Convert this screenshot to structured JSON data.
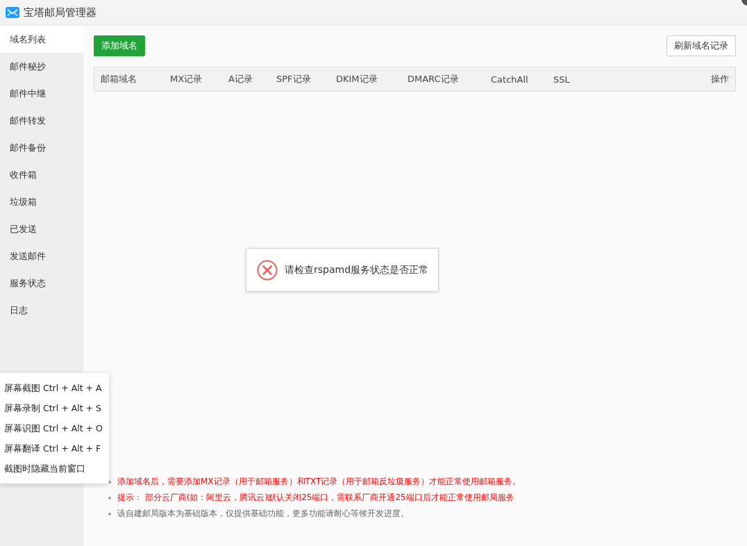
{
  "window": {
    "title": "宝塔邮局管理器"
  },
  "sidebar": {
    "items": [
      {
        "label": "域名列表",
        "selected": true
      },
      {
        "label": "邮件秘抄",
        "selected": false
      },
      {
        "label": "邮件中继",
        "selected": false
      },
      {
        "label": "邮件转发",
        "selected": false
      },
      {
        "label": "邮件备份",
        "selected": false
      },
      {
        "label": "收件箱",
        "selected": false
      },
      {
        "label": "垃圾箱",
        "selected": false
      },
      {
        "label": "已发送",
        "selected": false
      },
      {
        "label": "发送邮件",
        "selected": false
      },
      {
        "label": "服务状态",
        "selected": false
      },
      {
        "label": "日志",
        "selected": false
      }
    ]
  },
  "toolbar": {
    "add_button": "添加域名",
    "refresh_button": "刷新域名记录"
  },
  "table": {
    "columns": [
      "邮箱域名",
      "MX记录",
      "A记录",
      "SPF记录",
      "DKIM记录",
      "DMARC记录",
      "CatchAll",
      "SSL",
      "操作"
    ]
  },
  "notes": [
    {
      "kind": "warning",
      "text": "添加域名后，需要添加MX记录（用于邮箱服务）和TXT记录（用于邮箱反垃圾服务）才能正常使用邮箱服务。"
    },
    {
      "kind": "warning",
      "text": "提示： 部分云厂商(如：阿里云，腾讯云)默认关闭25端口，需联系厂商开通25端口后才能正常使用邮局服务"
    },
    {
      "kind": "info",
      "text": "该自建邮局版本为基础版本，仅提供基础功能，更多功能请耐心等候开发进度。"
    }
  ],
  "toast": {
    "kind": "error",
    "message": "请检查rspamd服务状态是否正常"
  },
  "context_menu": {
    "items": [
      "屏幕截图 Ctrl + Alt + A",
      "屏幕录制 Ctrl + Alt + S",
      "屏幕识图 Ctrl + Alt + O",
      "屏幕翻译 Ctrl + Alt + F",
      "截图时隐藏当前窗口"
    ]
  }
}
